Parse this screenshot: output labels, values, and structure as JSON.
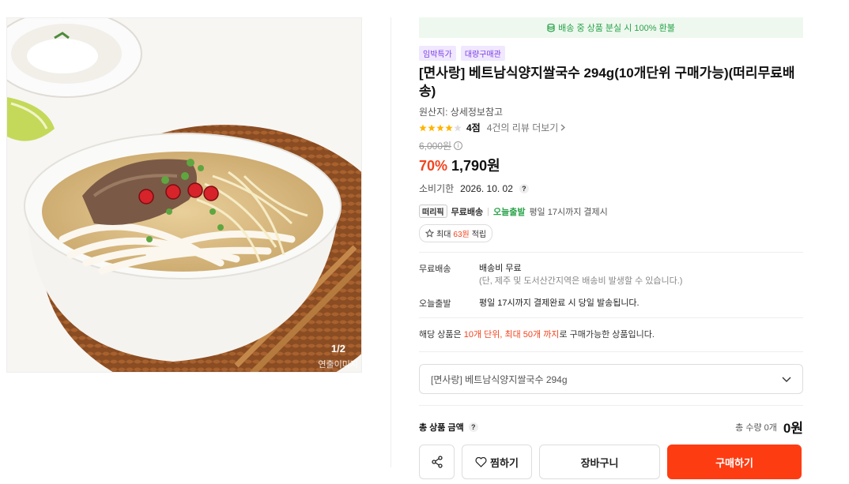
{
  "gallery": {
    "counter": "1/2",
    "watermark": "연출이미지"
  },
  "banner": {
    "refund_text": "배송 중 상품 분실 시 100% 환불"
  },
  "badges": [
    "임박특가",
    "대량구매관"
  ],
  "product": {
    "title": "[면사랑] 베트남식양지쌀국수 294g(10개단위 구매가능)(떠리무료배송)",
    "origin": "원산지: 상세정보참고",
    "rating_stars": 4,
    "rating_score": "4점",
    "review_link": "4건의 리뷰 더보기",
    "original_price": "6,000원",
    "discount": "70%",
    "sale_price": "1,790원",
    "expiry_label": "소비기한",
    "expiry_value": "2026. 10. 02"
  },
  "delivery": {
    "logo": "떠리픽",
    "free_shipping": "무료배송",
    "separator": "|",
    "today_ship": "오늘출발",
    "today_note": "평일 17시까지 결제시"
  },
  "points": {
    "prefix": "최대",
    "amount": "63원",
    "suffix": "적립"
  },
  "shipping_info": {
    "free_label": "무료배송",
    "free_value": "배송비 무료",
    "free_note": "(단, 제주 및 도서산간지역은 배송비 발생할 수 있습니다.)",
    "today_label": "오늘출발",
    "today_value": "평일 17시까지 결제완료 시 당일 발송됩니다."
  },
  "notice": {
    "pre": "해당 상품은 ",
    "hl": "10개 단위, 최대 50개 까지",
    "post": "로 구매가능한 상품입니다."
  },
  "option": {
    "selected": "[면사랑] 베트남식양지쌀국수 294g"
  },
  "total": {
    "label": "총 상품 금액",
    "qty": "총 수량 0개",
    "amount": "0원"
  },
  "actions": {
    "wish": "찜하기",
    "cart": "장바구니",
    "buy": "구매하기"
  },
  "colors": {
    "accent": "#fe3c12",
    "discount": "#f2431d",
    "green": "#2aa34a",
    "badge_purple": "#7b3fe4"
  }
}
